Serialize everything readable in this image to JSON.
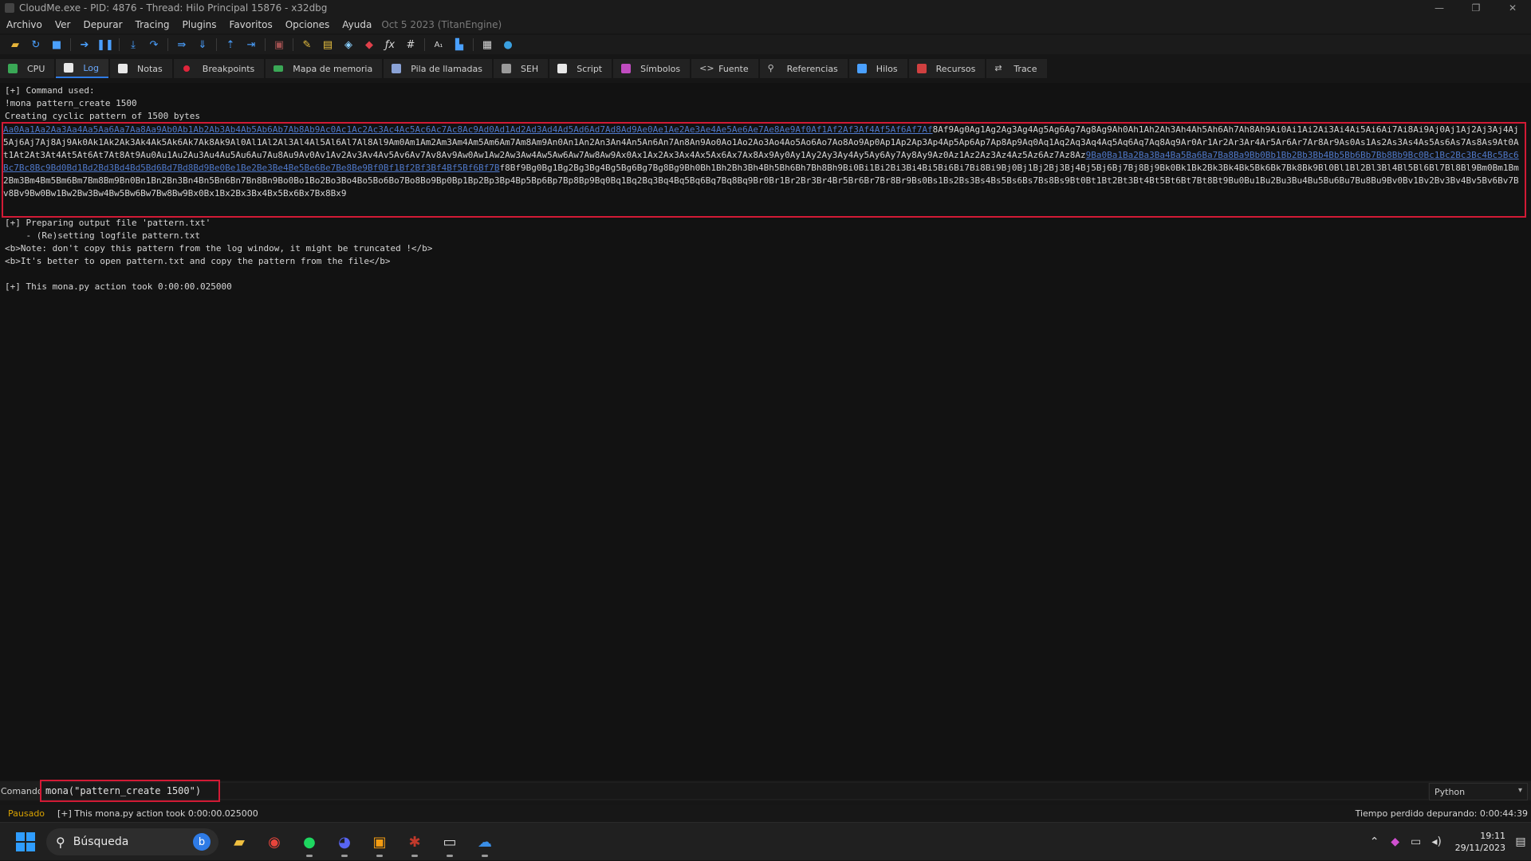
{
  "window": {
    "title": "CloudMe.exe - PID: 4876 - Thread: Hilo Principal 15876 - x32dbg",
    "minimize": "—",
    "restore": "❐",
    "close": "✕"
  },
  "menu": {
    "items": [
      "Archivo",
      "Ver",
      "Depurar",
      "Tracing",
      "Plugins",
      "Favoritos",
      "Opciones",
      "Ayuda"
    ],
    "build_info": "Oct 5 2023 (TitanEngine)"
  },
  "toolbar": {
    "icons": [
      "open-icon",
      "restart-icon",
      "stop-icon",
      "run-icon",
      "pause-icon",
      "step-into-icon",
      "step-over-icon",
      "trace-into-icon",
      "trace-over-icon",
      "execute-till-return-icon",
      "run-to-user-code-icon",
      "scylla-icon",
      "patch-icon",
      "comment-icon",
      "label-icon",
      "bookmark-icon",
      "function-icon",
      "hash-icon",
      "font-icon",
      "strings-icon",
      "calculator-icon",
      "globe-icon"
    ]
  },
  "tabs": [
    {
      "label": "CPU",
      "icon": "cpu-icon",
      "color": "#3aa856"
    },
    {
      "label": "Log",
      "icon": "log-icon",
      "color": "#e8e8e8"
    },
    {
      "label": "Notas",
      "icon": "notes-icon",
      "color": "#e8e8e8"
    },
    {
      "label": "Breakpoints",
      "icon": "breakpoint-icon",
      "color": "#e0253b"
    },
    {
      "label": "Mapa de memoria",
      "icon": "memory-map-icon",
      "color": "#3aa856"
    },
    {
      "label": "Pila de llamadas",
      "icon": "call-stack-icon",
      "color": "#8aa2d6"
    },
    {
      "label": "SEH",
      "icon": "seh-icon",
      "color": "#c8c8c8"
    },
    {
      "label": "Script",
      "icon": "script-icon",
      "color": "#e8e8e8"
    },
    {
      "label": "Símbolos",
      "icon": "symbols-icon",
      "color": "#c04cc0"
    },
    {
      "label": "Fuente",
      "icon": "source-icon",
      "color": "#c8c8c8"
    },
    {
      "label": "Referencias",
      "icon": "references-icon",
      "color": "#c8c8c8"
    },
    {
      "label": "Hilos",
      "icon": "threads-icon",
      "color": "#4aa0ff"
    },
    {
      "label": "Recursos",
      "icon": "resources-icon",
      "color": "#d04040"
    },
    {
      "label": "Trace",
      "icon": "trace-icon",
      "color": "#c8c8c8"
    }
  ],
  "log": {
    "header_lines": [
      "[+] Command used:",
      "!mona pattern_create 1500",
      "Creating cyclic pattern of 1500 bytes"
    ],
    "pattern_link_1": "Aa0Aa1Aa2Aa3Aa4Aa5Aa6Aa7Aa8Aa9Ab0Ab1Ab2Ab3Ab4Ab5Ab6Ab7Ab8Ab9Ac0Ac1Ac2Ac3Ac4Ac5Ac6Ac7Ac8Ac9Ad0Ad1Ad2Ad3Ad4Ad5Ad6Ad7Ad8Ad9Ae0Ae1Ae2Ae3Ae4Ae5Ae6Ae7Ae8Ae9Af0Af1Af2Af3Af4Af5Af6Af7Af",
    "pattern_text_1": "8Af9Ag0Ag1Ag2Ag3Ag4Ag5Ag6Ag7Ag8Ag9Ah0Ah1Ah2Ah3Ah4Ah5Ah6Ah7Ah8Ah9Ai0Ai1Ai2Ai3Ai4Ai5Ai6Ai7Ai8Ai9Aj0Aj1Aj2Aj3Aj4Aj5Aj6Aj7Aj8Aj9Ak0Ak1Ak2Ak3Ak4Ak5Ak6Ak7Ak8Ak9Al0Al1Al2Al3Al4Al5Al6Al7Al8Al9Am0Am1Am2Am3Am4Am5Am6Am7Am8Am9An0An1An2An3An4An5An6An7An8An9Ao0Ao1Ao2Ao3Ao4Ao5Ao6Ao7Ao8Ao9Ap0Ap1Ap2Ap3Ap4Ap5Ap6Ap7Ap8Ap9Aq0Aq1Aq2Aq3Aq4Aq5Aq6Aq7Aq8Aq9Ar0Ar1Ar2Ar3Ar4Ar5Ar6Ar7Ar8Ar9As0As1As2As3As4As5As6As7As8As9At0At1At2At3At4At5At6At7At8At9Au0Au1Au2Au3Au4Au5Au6Au7Au8Au9Av0Av1Av2Av3Av4Av5Av6Av7Av8Av9Aw0Aw1Aw2Aw3Aw4Aw5Aw6Aw7Aw8Aw9Ax0Ax1Ax2Ax3Ax4Ax5Ax6Ax7Ax8Ax9Ay0Ay1Ay2Ay3Ay4Ay5Ay6Ay7Ay8Ay9Az0Az1Az2Az3Az4Az5Az6Az7Az8Az",
    "pattern_link_2": "9Ba0Ba1Ba2Ba3Ba4Ba5Ba6Ba7Ba8Ba9Bb0Bb1Bb2Bb3Bb4Bb5Bb6Bb7Bb8Bb9Bc0Bc1Bc2Bc3Bc4Bc5Bc6Bc7Bc8Bc9Bd0Bd1Bd2Bd3Bd4Bd5Bd6Bd7Bd8Bd9Be0Be1Be2Be3Be4Be5Be6Be7Be8Be9Bf0Bf1Bf2Bf3Bf4Bf5Bf6Bf7B",
    "pattern_text_2": "f8Bf9Bg0Bg1Bg2Bg3Bg4Bg5Bg6Bg7Bg8Bg9Bh0Bh1Bh2Bh3Bh4Bh5Bh6Bh7Bh8Bh9Bi0Bi1Bi2Bi3Bi4Bi5Bi6Bi7Bi8Bi9Bj0Bj1Bj2Bj3Bj4Bj5Bj6Bj7Bj8Bj9Bk0Bk1Bk2Bk3Bk4Bk5Bk6Bk7Bk8Bk9Bl0Bl1Bl2Bl3Bl4Bl5Bl6Bl7Bl8Bl9Bm0Bm1Bm2Bm3Bm4Bm5Bm6Bm7Bm8Bm9Bn0Bn1Bn2Bn3Bn4Bn5Bn6Bn7Bn8Bn9Bo0Bo1Bo2Bo3Bo4Bo5Bo6Bo7Bo8Bo9Bp0Bp1Bp2Bp3Bp4Bp5Bp6Bp7Bp8Bp9Bq0Bq1Bq2Bq3Bq4Bq5Bq6Bq7Bq8Bq9Br0Br1Br2Br3Br4Br5Br6Br7Br8Br9Bs0Bs1Bs2Bs3Bs4Bs5Bs6Bs7Bs8Bs9Bt0Bt1Bt2Bt3Bt4Bt5Bt6Bt7Bt8Bt9Bu0Bu1Bu2Bu3Bu4Bu5Bu6Bu7Bu8Bu9Bv0Bv1Bv2Bv3Bv4Bv5Bv6Bv7Bv8Bv9Bw0Bw1Bw2Bw3Bw4Bw5Bw6Bw7Bw8Bw9Bx0Bx1Bx2Bx3Bx4Bx5Bx6Bx7Bx8Bx9",
    "footer_lines": [
      "[+] Preparing output file 'pattern.txt'",
      "    - (Re)setting logfile pattern.txt",
      "<b>Note: don't copy this pattern from the log window, it might be truncated !</b>",
      "<b>It's better to open pattern.txt and copy the pattern from the file</b>",
      "",
      "[+] This mona.py action took 0:00:00.025000"
    ]
  },
  "command": {
    "label": "Comando:",
    "value": "mona(\"pattern_create 1500\")",
    "language": "Python"
  },
  "status": {
    "state": "Pausado",
    "message": "[+] This mona.py action took 0:00:00.025000",
    "timer": "Tiempo perdido depurando: 0:00:44:39"
  },
  "taskbar": {
    "search_placeholder": "Búsqueda",
    "time": "19:11",
    "date": "29/11/2023",
    "apps": [
      "file-explorer-icon",
      "chrome-icon",
      "spotify-icon",
      "discord-icon",
      "remote-desktop-icon",
      "debugger-icon",
      "terminal-icon",
      "cloudme-icon"
    ]
  },
  "colors": {
    "highlight_border": "#d21a35",
    "link": "#4f78c9",
    "paused": "#d8a100",
    "accent": "#2f7be5"
  }
}
